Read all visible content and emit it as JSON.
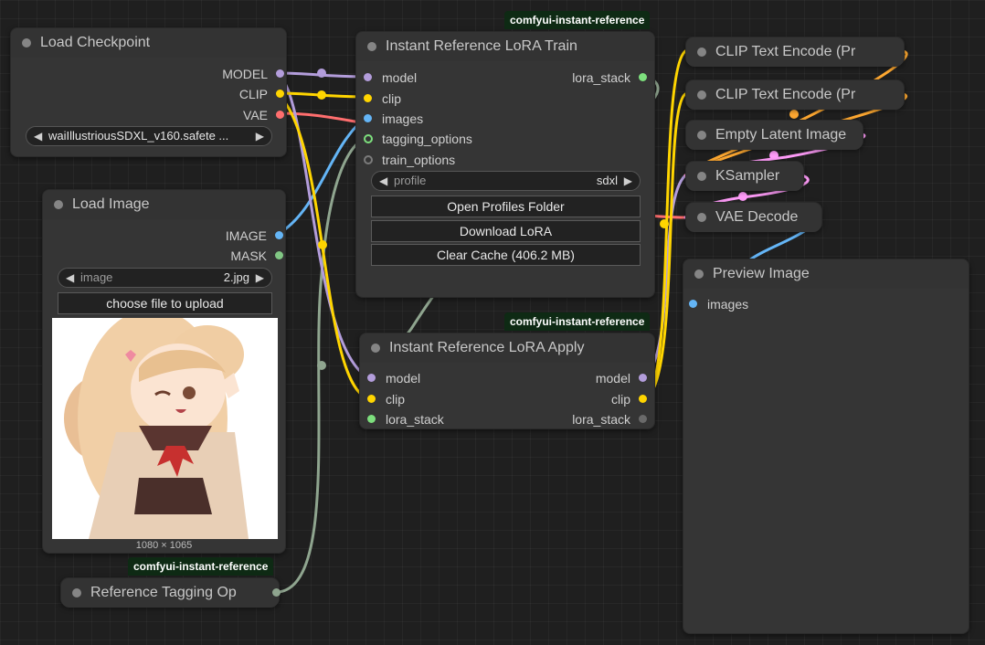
{
  "badges": {
    "train": "comfyui-instant-reference",
    "apply": "comfyui-instant-reference",
    "tagging": "comfyui-instant-reference"
  },
  "nodes": {
    "load_checkpoint": {
      "title": "Load Checkpoint",
      "outputs": [
        "MODEL",
        "CLIP",
        "VAE"
      ],
      "ckpt_value": "waiIllustriousSDXL_v160.safete ..."
    },
    "load_image": {
      "title": "Load Image",
      "outputs": [
        "IMAGE",
        "MASK"
      ],
      "image_label": "image",
      "image_value": "2.jpg",
      "upload_label": "choose file to upload",
      "dimensions": "1080 × 1065"
    },
    "train": {
      "title": "Instant Reference LoRA Train",
      "inputs": [
        "model",
        "clip",
        "images",
        "tagging_options",
        "train_options"
      ],
      "outputs": [
        "lora_stack"
      ],
      "profile_label": "profile",
      "profile_value": "sdxl",
      "buttons": [
        "Open Profiles Folder",
        "Download LoRA",
        "Clear Cache (406.2 MB)"
      ]
    },
    "apply": {
      "title": "Instant Reference LoRA Apply",
      "inputs": [
        "model",
        "clip",
        "lora_stack"
      ],
      "outputs": [
        "model",
        "clip",
        "lora_stack"
      ]
    },
    "tagging": {
      "title": "Reference Tagging Op"
    },
    "clip1": {
      "title": "CLIP Text Encode (Pr"
    },
    "clip2": {
      "title": "CLIP Text Encode (Pr"
    },
    "latent": {
      "title": "Empty Latent Image"
    },
    "ksampler": {
      "title": "KSampler"
    },
    "vae_decode": {
      "title": "VAE Decode"
    },
    "preview": {
      "title": "Preview Image",
      "inputs": [
        "images"
      ]
    }
  },
  "colors": {
    "model": "#b39ddb",
    "clip": "#ffd500",
    "vae": "#ff6e6e",
    "image": "#64b5f6",
    "mask": "#81c784",
    "lora_stack": "#7ddf7d",
    "conditioning": "#ffa931",
    "latent": "#ff9cf9",
    "tagging": "#8fa58f"
  }
}
